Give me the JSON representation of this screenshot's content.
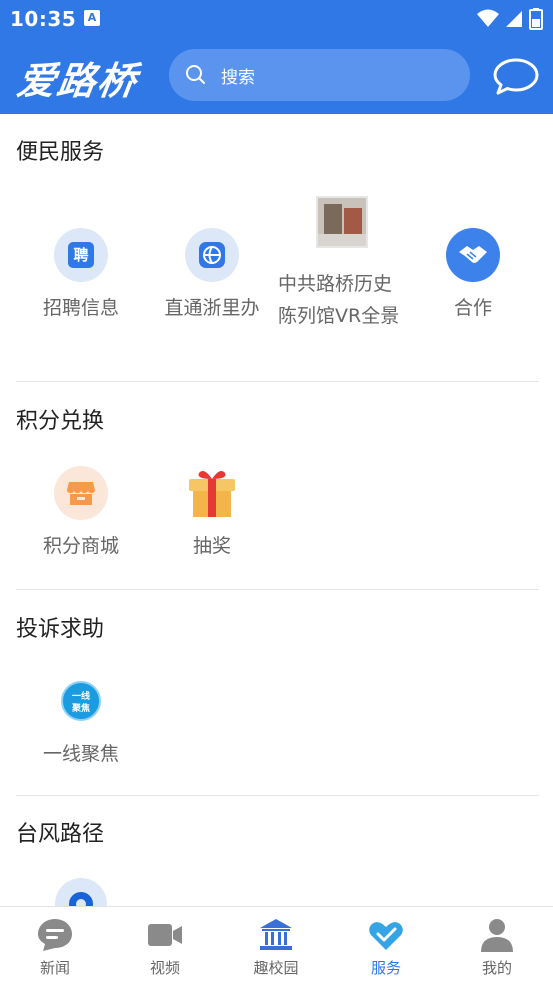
{
  "status_bar": {
    "time": "10:35",
    "notification_letter": "A"
  },
  "header": {
    "logo": "爱路桥",
    "search_placeholder": "搜索"
  },
  "sections": [
    {
      "title": "便民服务",
      "items": [
        "招聘信息",
        "直通浙里办",
        "中共路桥历史陈列馆VR全景",
        "合作"
      ]
    },
    {
      "title": "积分兑换",
      "items": [
        "积分商城",
        "抽奖"
      ]
    },
    {
      "title": "投诉求助",
      "items": [
        "一线聚焦"
      ]
    },
    {
      "title": "台风路径",
      "items": []
    }
  ],
  "icons": {
    "recruit_icon_text": "聘",
    "focus_icon_line1": "一线",
    "focus_icon_line2": "聚焦"
  },
  "bottom_nav": [
    {
      "label": "新闻",
      "icon": "news-icon"
    },
    {
      "label": "视频",
      "icon": "video-icon"
    },
    {
      "label": "趣校园",
      "icon": "campus-icon"
    },
    {
      "label": "服务",
      "icon": "service-heart-icon",
      "active": true
    },
    {
      "label": "我的",
      "icon": "profile-icon"
    }
  ],
  "colors": {
    "brand": "#2f78e6",
    "active": "#2f78e6",
    "inactive": "#666666"
  }
}
